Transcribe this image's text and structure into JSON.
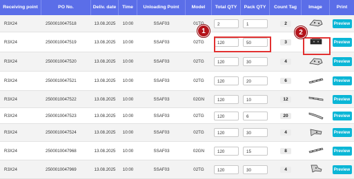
{
  "header": {
    "columns": [
      "Receiving point",
      "PO No.",
      "Deliv. date",
      "Time",
      "Unloading Point",
      "Model",
      "Total QTY",
      "Pack QTY",
      "Count Tag",
      "Image",
      "Print"
    ]
  },
  "rows": [
    {
      "receiving_point": "R3X24",
      "po_no": "250001004751​8",
      "date": "13.08.2025",
      "time": "10:00",
      "unloading_point": "SSAF03",
      "model": "01TG",
      "total_qty": "2",
      "pack_qty": "1",
      "count_tag": "2",
      "image": "part-bracket-icon",
      "print": "Preview"
    },
    {
      "receiving_point": "R3X24",
      "po_no": "2500010047519",
      "date": "13.08.2025",
      "time": "10:00",
      "unloading_point": "SSAF03",
      "model": "02TG",
      "total_qty": "120",
      "pack_qty": "50",
      "count_tag": "3",
      "image": "part-block-icon",
      "print": "Preview"
    },
    {
      "receiving_point": "R3X24",
      "po_no": "2500010047520",
      "date": "13.08.2025",
      "time": "10:00",
      "unloading_point": "SSAF03",
      "model": "02TG",
      "total_qty": "120",
      "pack_qty": "30",
      "count_tag": "4",
      "image": "part-bracket-icon",
      "print": "Preview"
    },
    {
      "receiving_point": "R3X24",
      "po_no": "2500010047521",
      "date": "13.08.2025",
      "time": "10:00",
      "unloading_point": "SSAF03",
      "model": "02TG",
      "total_qty": "120",
      "pack_qty": "20",
      "count_tag": "6",
      "image": "part-rail-icon",
      "print": "Preview"
    },
    {
      "receiving_point": "R3X24",
      "po_no": "2500010047522",
      "date": "13.08.2025",
      "time": "10:00",
      "unloading_point": "SSAF03",
      "model": "02GN",
      "total_qty": "120",
      "pack_qty": "10",
      "count_tag": "12",
      "image": "part-strip-icon",
      "print": "Preview"
    },
    {
      "receiving_point": "R3X24",
      "po_no": "2500010047523",
      "date": "13.08.2025",
      "time": "10:00",
      "unloading_point": "SSAF03",
      "model": "02TG",
      "total_qty": "120",
      "pack_qty": "6",
      "count_tag": "20",
      "image": "part-curve-icon",
      "print": "Preview"
    },
    {
      "receiving_point": "R3X24",
      "po_no": "2500010047524",
      "date": "13.08.2025",
      "time": "10:00",
      "unloading_point": "SSAF03",
      "model": "02TG",
      "total_qty": "120",
      "pack_qty": "30",
      "count_tag": "4",
      "image": "part-arm-icon",
      "print": "Preview"
    },
    {
      "receiving_point": "R3X24",
      "po_no": "2500010047968",
      "date": "13.08.2025",
      "time": "10:00",
      "unloading_point": "SSAF03",
      "model": "02GN",
      "total_qty": "120",
      "pack_qty": "15",
      "count_tag": "8",
      "image": "part-rail-icon",
      "print": "Preview"
    },
    {
      "receiving_point": "R3X24",
      "po_no": "2500010047969",
      "date": "13.08.2025",
      "time": "10:00",
      "unloading_point": "SSAF03",
      "model": "02TG",
      "total_qty": "120",
      "pack_qty": "30",
      "count_tag": "4",
      "image": "part-hook-icon",
      "print": "Preview"
    }
  ],
  "annotations": {
    "callout_1": "1",
    "callout_2": "2",
    "highlight_color": "#e23030",
    "callout_color": "#b4141b"
  },
  "colors": {
    "header_bg": "#5b6ee8",
    "button_bg": "#0ab6d6"
  }
}
